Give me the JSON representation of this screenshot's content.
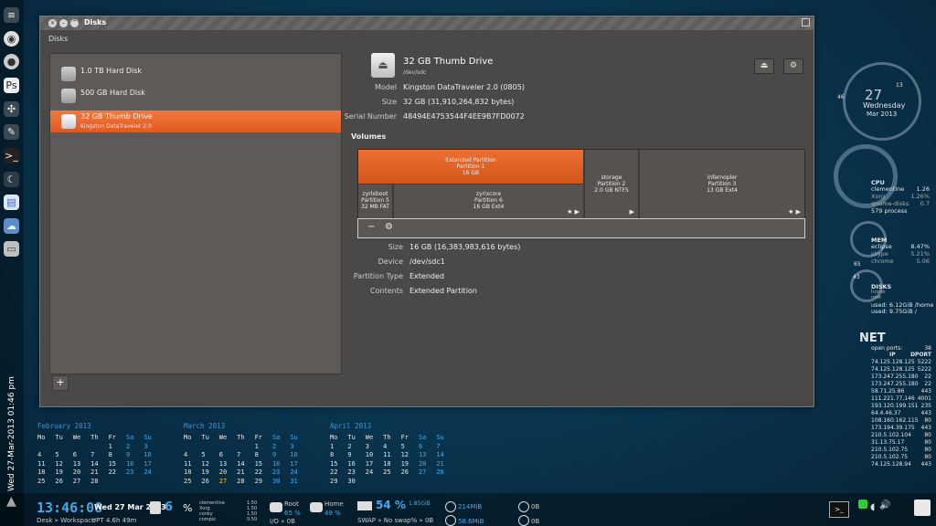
{
  "desktop": {
    "side_date": "Wed 27-Mar-2013 01:46 pm",
    "dock_icons": [
      "equalizer-icon",
      "chrome-icon",
      "disk-icon",
      "photoshop-icon",
      "settings-icon",
      "pen-icon",
      "terminal-icon",
      "moon-icon",
      "document-icon",
      "chat-icon",
      "disk-drive-icon"
    ]
  },
  "window": {
    "title": "Disks",
    "breadcrumb": "Disks",
    "disks": [
      {
        "name": "1.0 TB Hard Disk",
        "sub": ""
      },
      {
        "name": "500 GB Hard Disk",
        "sub": ""
      },
      {
        "name": "32 GB Thumb Drive",
        "sub": "Kingston DataTraveler 2.0"
      }
    ],
    "add_label": "+",
    "device": {
      "title": "32 GB Thumb Drive",
      "path": "/dev/sdc",
      "model_label": "Model",
      "model": "Kingston DataTraveler 2.0 (0805)",
      "size_label": "Size",
      "size": "32 GB (31,910,264,832 bytes)",
      "serial_label": "Serial Number",
      "serial": "48494E4753544F4EE9B7FD0072"
    },
    "volumes_label": "Volumes",
    "segments": {
      "extended": [
        "Extended Partition",
        "Partition 1",
        "16 GB"
      ],
      "storage": [
        "storage",
        "Partition 2",
        "2.0 GB NTFS"
      ],
      "infernopler": [
        "infernopler",
        "Partition 3",
        "13 GB Ext4"
      ],
      "zyrlxboot": [
        "zyrlxboot",
        "Partition 5",
        "32 MB FAT"
      ],
      "zyrlxcore": [
        "zyrlxcore",
        "Partition 6",
        "16 GB Ext4"
      ]
    },
    "tools": {
      "minus": "−",
      "gear": "⚙"
    },
    "partition": {
      "size_label": "Size",
      "size": "16 GB (16,383,983,616 bytes)",
      "device_label": "Device",
      "device": "/dev/sdc1",
      "type_label": "Partition Type",
      "type": "Extended",
      "contents_label": "Contents",
      "contents": "Extended Partition"
    }
  },
  "calendars": [
    {
      "title": "February 2013",
      "days": [
        "Mo",
        "Tu",
        "We",
        "Th",
        "Fr",
        "Sa",
        "Su"
      ],
      "rows": [
        [
          "",
          "",
          "",
          "",
          "1",
          "2",
          "3"
        ],
        [
          "4",
          "5",
          "6",
          "7",
          "8",
          "9",
          "10"
        ],
        [
          "11",
          "12",
          "13",
          "14",
          "15",
          "16",
          "17"
        ],
        [
          "18",
          "19",
          "20",
          "21",
          "22",
          "23",
          "24"
        ],
        [
          "25",
          "26",
          "27",
          "28",
          "",
          "",
          ""
        ]
      ]
    },
    {
      "title": "March 2013",
      "days": [
        "Mo",
        "Tu",
        "We",
        "Th",
        "Fr",
        "Sa",
        "Su"
      ],
      "rows": [
        [
          "",
          "",
          "",
          "",
          "1",
          "2",
          "3"
        ],
        [
          "4",
          "5",
          "6",
          "7",
          "8",
          "9",
          "10"
        ],
        [
          "11",
          "12",
          "13",
          "14",
          "15",
          "16",
          "17"
        ],
        [
          "18",
          "19",
          "20",
          "21",
          "22",
          "23",
          "24"
        ],
        [
          "25",
          "26",
          "27",
          "28",
          "29",
          "30",
          "31"
        ]
      ]
    },
    {
      "title": "April 2013",
      "days": [
        "Mo",
        "Tu",
        "We",
        "Th",
        "Fr",
        "Sa",
        "Su"
      ],
      "rows": [
        [
          "1",
          "2",
          "3",
          "4",
          "5",
          "6",
          "7"
        ],
        [
          "8",
          "9",
          "10",
          "11",
          "12",
          "13",
          "14"
        ],
        [
          "15",
          "16",
          "17",
          "18",
          "19",
          "20",
          "21"
        ],
        [
          "22",
          "23",
          "24",
          "25",
          "26",
          "27",
          "28"
        ],
        [
          "29",
          "30",
          "",
          "",
          "",
          "",
          ""
        ]
      ]
    }
  ],
  "bottom": {
    "time": "13:46:08",
    "date": "Wed 27 Mar 2013",
    "workspace": "Desk » Workspace",
    "uptime": "UPT 4.6h 49m",
    "cpu_count": "6",
    "procs": [
      "clementine",
      "Xorg",
      "conky",
      "compiz"
    ],
    "proc_vals": [
      "1.50",
      "1.50",
      "1.50",
      "0.50"
    ],
    "root_label": "Root",
    "root_pct": "65 %",
    "io_label": "I/O » 0B",
    "home_label": "Home",
    "home_pct": "49 %",
    "mem_pct": "54 %",
    "mem_size": "1.85GiB",
    "swap": "SWAP » No swap% » 0B",
    "net_down": "214MiB",
    "net_up": "58.6MiB",
    "dl_up": "0B",
    "dl_down": "0B"
  },
  "conky": {
    "clock_hour": "27",
    "day": "Wednesday",
    "month_year": "Mar 2013",
    "deg_13": "13",
    "deg_46": "46",
    "cpu_title": "CPU",
    "cpu_rows": [
      [
        "clementine",
        "1.26"
      ],
      [
        "Xorg",
        "1.26%"
      ],
      [
        "gnome-disks",
        "0.7"
      ]
    ],
    "cpu_procs": "579 process",
    "mem_title": "MEM",
    "mem_rows": [
      [
        "eclipse",
        "8.47%"
      ],
      [
        "skype",
        "5.21%"
      ],
      [
        "chrome",
        "5.06"
      ]
    ],
    "mem_val": "65",
    "disks_title": "DISKS",
    "disks_rows": [
      "home",
      "root"
    ],
    "disks_val": "43",
    "used_home": "used: 6.12GiB /home",
    "used_root": "used: 9.75GiB /",
    "net_title": "NET",
    "open_ports_label": "open ports:",
    "open_ports": "38",
    "ip_head": "IP",
    "dport_head": "DPORT",
    "connections": [
      [
        "74.125.128.125",
        "5222"
      ],
      [
        "74.125.128.125",
        "5222"
      ],
      [
        "173.247.255.180",
        "22"
      ],
      [
        "173.247.255.180",
        "22"
      ],
      [
        "58.71.25.86",
        "443"
      ],
      [
        "111.221.77.146",
        "4001"
      ],
      [
        "193.120.199.151",
        "235"
      ],
      [
        "64.4.46.37",
        "443"
      ],
      [
        "108.160.162.115",
        "80"
      ],
      [
        "173.194.39.175",
        "443"
      ],
      [
        "210.5.102.104",
        "80"
      ],
      [
        "31.13.75.17",
        "80"
      ],
      [
        "210.5.102.75",
        "80"
      ],
      [
        "210.5.102.75",
        "80"
      ],
      [
        "74.125.128.94",
        "443"
      ]
    ]
  }
}
